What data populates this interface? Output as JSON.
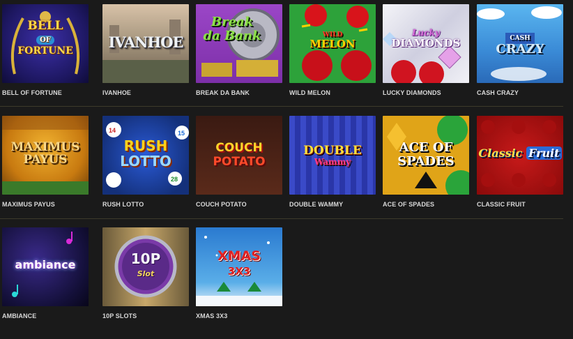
{
  "games": [
    {
      "label": "BELL OF FORTUNE",
      "logo": [
        "BELL",
        "OF",
        "FORTUNE"
      ]
    },
    {
      "label": "IVANHOE",
      "logo": [
        "IVANHOE"
      ]
    },
    {
      "label": "BREAK DA BANK",
      "logo": [
        "Break",
        "da Bank"
      ]
    },
    {
      "label": "WILD MELON",
      "logo": [
        "WILD",
        "MELON"
      ]
    },
    {
      "label": "LUCKY DIAMONDS",
      "logo": [
        "Lucky",
        "DIAMONDS"
      ]
    },
    {
      "label": "CASH CRAZY",
      "logo": [
        "CASH",
        "CRAZY"
      ]
    },
    {
      "label": "MAXIMUS PAYUS",
      "logo": [
        "MAXIMUS",
        "PAYUS"
      ]
    },
    {
      "label": "RUSH LOTTO",
      "logo": [
        "RUSH",
        "LOTTO"
      ]
    },
    {
      "label": "COUCH POTATO",
      "logo": [
        "COUCH",
        "POTATO"
      ]
    },
    {
      "label": "DOUBLE WAMMY",
      "logo": [
        "DOUBLE",
        "Wammy"
      ]
    },
    {
      "label": "ACE OF SPADES",
      "logo": [
        "ACE OF",
        "SPADES"
      ]
    },
    {
      "label": "CLASSIC FRUIT",
      "logo": [
        "Classic",
        "Fruit"
      ]
    },
    {
      "label": "AMBIANCE",
      "logo": [
        "ambiance"
      ]
    },
    {
      "label": "10P SLOTS",
      "logo": [
        "10P",
        "Slot"
      ]
    },
    {
      "label": "XMAS 3X3",
      "logo": [
        "XMAS",
        "3X3"
      ]
    }
  ],
  "lotto_balls": [
    "14",
    "15",
    "28"
  ]
}
